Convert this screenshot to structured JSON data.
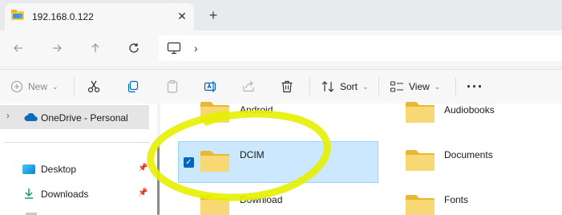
{
  "tab": {
    "title": "192.168.0.122",
    "close_glyph": "✕",
    "new_tab_glyph": "+"
  },
  "nav": {
    "back_icon": "arrow-left-icon",
    "forward_icon": "arrow-right-icon",
    "up_icon": "arrow-up-icon",
    "refresh_icon": "refresh-icon",
    "address_chevron": "›"
  },
  "commands": {
    "new_label": "New",
    "sort_label": "Sort",
    "view_label": "View",
    "more_glyph": "···"
  },
  "sidebar": {
    "items": [
      {
        "label": "OneDrive - Personal",
        "icon": "cloud-icon"
      },
      {
        "label": "Desktop",
        "icon": "desktop-icon"
      },
      {
        "label": "Downloads",
        "icon": "download-icon"
      }
    ]
  },
  "files": {
    "items": [
      {
        "name": "Android"
      },
      {
        "name": "Audiobooks"
      },
      {
        "name": "DCIM",
        "selected": true
      },
      {
        "name": "Documents"
      },
      {
        "name": "Download"
      },
      {
        "name": "Fonts"
      }
    ]
  },
  "colors": {
    "accent": "#0067c0",
    "selection": "#cce8ff",
    "folder": "#f8d775",
    "highlight_stroke": "#e6ef00"
  }
}
